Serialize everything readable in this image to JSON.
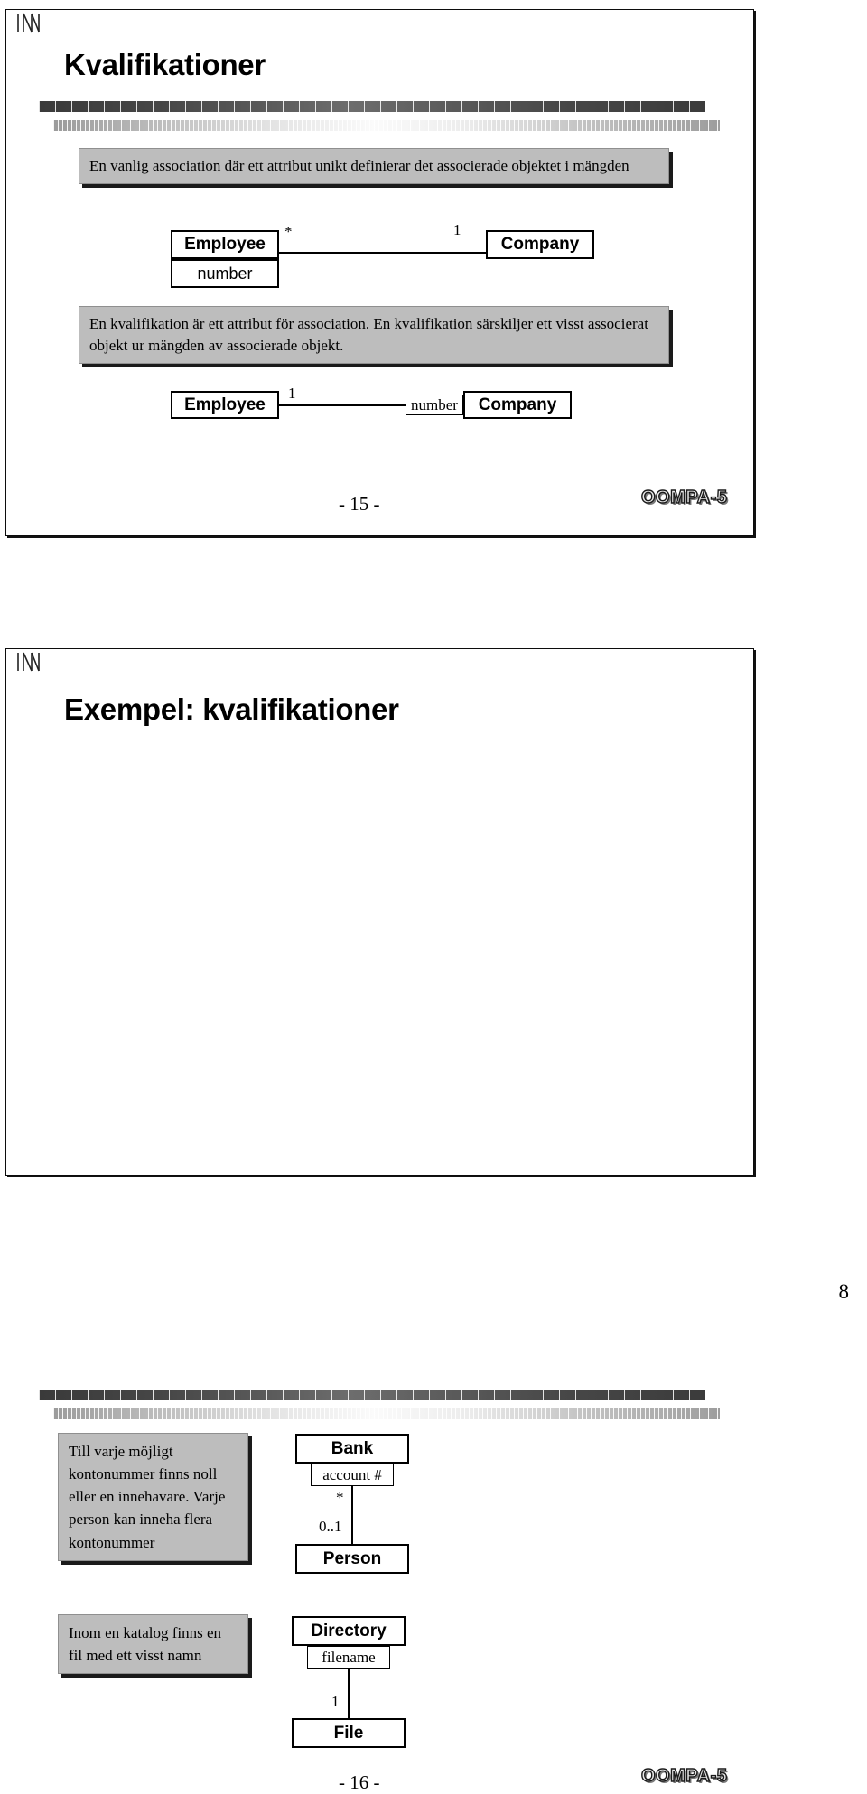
{
  "document": {
    "page_number": "8"
  },
  "slides": [
    {
      "corner_mark": "inn-logo-mark",
      "title": "Kvalifikationer",
      "callouts": [
        "En vanlig association där ett attribut unikt definierar det associerade objektet i mängden",
        "En kvalifikation är ett attribut för association. En kvalifikation särskiljer ett visst associerat objekt ur mängden av associerade objekt."
      ],
      "diagram_1": {
        "left_class": "Employee",
        "left_attribute": "number",
        "right_class": "Company",
        "left_multiplicity": "*",
        "right_multiplicity": "1"
      },
      "diagram_2": {
        "left_class": "Employee",
        "left_multiplicity": "1",
        "qualifier": "number",
        "right_class": "Company"
      },
      "page_label": "- 15 -",
      "logo": "OOMPA-5"
    },
    {
      "corner_mark": "inn-logo-mark",
      "title": "Exempel: kvalifikationer",
      "callouts": [
        "Till varje möjligt kontonummer finns noll eller en innehavare. Varje person kan inneha flera kontonummer",
        "Inom en katalog finns en fil med ett visst namn"
      ],
      "diagram_1": {
        "top_class": "Bank",
        "qualifier": "account #",
        "top_multiplicity": "*",
        "bottom_multiplicity": "0..1",
        "bottom_class": "Person"
      },
      "diagram_2": {
        "top_class": "Directory",
        "qualifier": "filename",
        "bottom_multiplicity": "1",
        "bottom_class": "File"
      },
      "page_label": "- 16 -",
      "logo": "OOMPA-5"
    }
  ]
}
